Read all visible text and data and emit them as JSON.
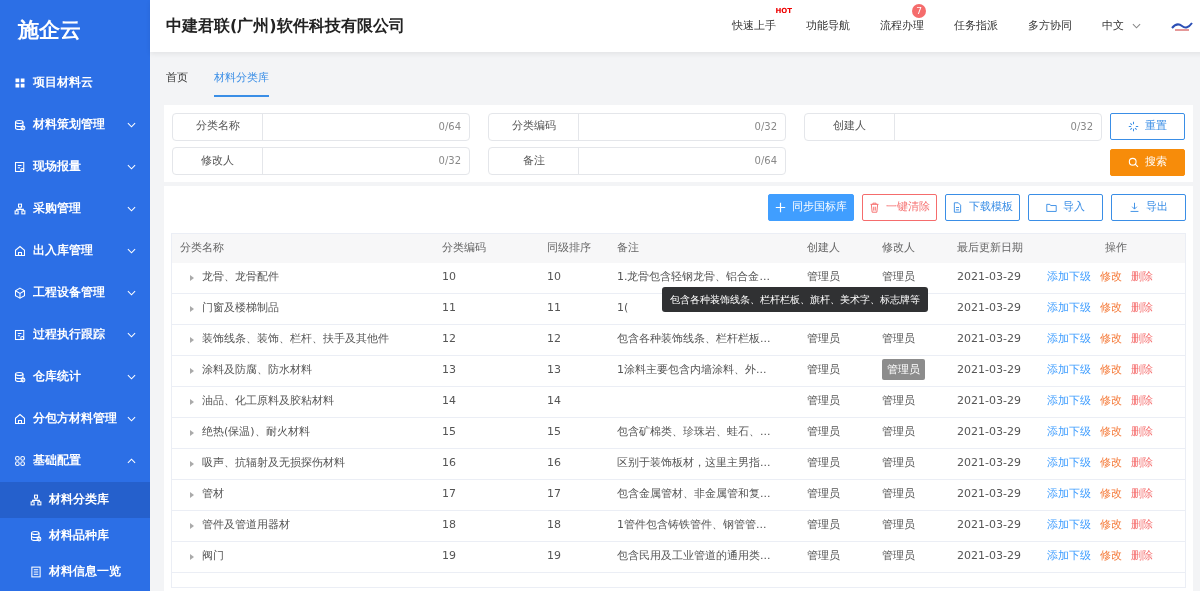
{
  "logo": {
    "text": "施企云"
  },
  "sidebar": {
    "items": [
      {
        "label": "项目材料云",
        "kind": "link"
      },
      {
        "label": "材料策划管理",
        "kind": "group",
        "expanded": false
      },
      {
        "label": "现场报量",
        "kind": "group",
        "expanded": false
      },
      {
        "label": "采购管理",
        "kind": "group",
        "expanded": false
      },
      {
        "label": "出入库管理",
        "kind": "group",
        "expanded": false
      },
      {
        "label": "工程设备管理",
        "kind": "group",
        "expanded": false
      },
      {
        "label": "过程执行跟踪",
        "kind": "group",
        "expanded": false
      },
      {
        "label": "仓库统计",
        "kind": "group",
        "expanded": false
      },
      {
        "label": "分包方材料管理",
        "kind": "group",
        "expanded": false
      },
      {
        "label": "基础配置",
        "kind": "group",
        "expanded": true,
        "children": [
          {
            "label": "材料分类库",
            "selected": true
          },
          {
            "label": "材料品种库",
            "selected": false
          },
          {
            "label": "材料信息一览",
            "selected": false
          }
        ]
      }
    ]
  },
  "header": {
    "company": "中建君联(广州)软件科技有限公司",
    "nav": [
      {
        "label": "快速上手",
        "hot": "HOT"
      },
      {
        "label": "功能导航"
      },
      {
        "label": "流程办理",
        "badge": "7"
      },
      {
        "label": "任务指派"
      },
      {
        "label": "多方协同"
      }
    ],
    "language": "中文"
  },
  "tabs": [
    {
      "label": "首页",
      "selected": false
    },
    {
      "label": "材料分类库",
      "selected": true
    }
  ],
  "filters": [
    {
      "label": "分类名称",
      "counter": "0/64"
    },
    {
      "label": "分类编码",
      "counter": "0/32"
    },
    {
      "label": "创建人",
      "counter": "0/32"
    },
    {
      "label": "修改人",
      "counter": "0/32"
    },
    {
      "label": "备注",
      "counter": "0/64"
    }
  ],
  "filter_buttons": [
    {
      "label": "重置",
      "kind": "reset"
    },
    {
      "label": "搜索",
      "kind": "search"
    }
  ],
  "toolbar": [
    {
      "label": "同步国标库",
      "kind": "primary"
    },
    {
      "label": "一键清除",
      "kind": "danger"
    },
    {
      "label": "下载模板",
      "kind": "file"
    },
    {
      "label": "导入",
      "kind": "folder"
    },
    {
      "label": "导出",
      "kind": "download"
    }
  ],
  "table": {
    "columns": [
      "分类名称",
      "分类编码",
      "同级排序",
      "备注",
      "创建人",
      "修改人",
      "最后更新日期",
      "操作"
    ],
    "rows": [
      {
        "name": "龙骨、龙骨配件",
        "code": "10",
        "sort": "10",
        "note": "1.龙骨包含轻钢龙骨、铝合金...",
        "creator": "管理员",
        "modifier": "管理员",
        "date": "2021-03-29",
        "actions": [
          "添加下级",
          "修改",
          "删除"
        ]
      },
      {
        "name": "门窗及楼梯制品",
        "code": "11",
        "sort": "11",
        "note": "1(",
        "note_tooltip": "包含各种装饰线条、栏杆栏板、旗杆、美术字、标志牌等",
        "date": "2021-03-29",
        "actions": [
          "添加下级",
          "修改",
          "删除"
        ]
      },
      {
        "name": "装饰线条、装饰、栏杆、扶手及其他件",
        "code": "12",
        "sort": "12",
        "note": "包含各种装饰线条、栏杆栏板...",
        "creator": "管理员",
        "modifier": "管理员",
        "date": "2021-03-29",
        "actions": [
          "添加下级",
          "修改",
          "删除"
        ]
      },
      {
        "name": "涂料及防腐、防水材料",
        "code": "13",
        "sort": "13",
        "note": "1涂料主要包含内墙涂料、外...",
        "creator": "管理员",
        "modifier": "管理员",
        "modifier_hovered": true,
        "date": "2021-03-29",
        "actions": [
          "添加下级",
          "修改",
          "删除"
        ]
      },
      {
        "name": "油品、化工原料及胶粘材料",
        "code": "14",
        "sort": "14",
        "creator": "管理员",
        "modifier": "管理员",
        "date": "2021-03-29",
        "actions": [
          "添加下级",
          "修改",
          "删除"
        ]
      },
      {
        "name": "绝热(保温)、耐火材料",
        "code": "15",
        "sort": "15",
        "note": "包含矿棉类、珍珠岩、蛙石、...",
        "creator": "管理员",
        "modifier": "管理员",
        "date": "2021-03-29",
        "actions": [
          "添加下级",
          "修改",
          "删除"
        ]
      },
      {
        "name": "吸声、抗辐射及无损探伤材料",
        "code": "16",
        "sort": "16",
        "note": "区别于装饰板材，这里主男指...",
        "creator": "管理员",
        "modifier": "管理员",
        "date": "2021-03-29",
        "actions": [
          "添加下级",
          "修改",
          "删除"
        ]
      },
      {
        "name": "管材",
        "code": "17",
        "sort": "17",
        "note": "包含金属管材、非金属管和复...",
        "creator": "管理员",
        "modifier": "管理员",
        "date": "2021-03-29",
        "actions": [
          "添加下级",
          "修改",
          "删除"
        ]
      },
      {
        "name": "管件及管道用器材",
        "code": "18",
        "sort": "18",
        "note": "1管件包含铸铁管件、钢管管...",
        "creator": "管理员",
        "modifier": "管理员",
        "date": "2021-03-29",
        "actions": [
          "添加下级",
          "修改",
          "删除"
        ]
      },
      {
        "name": "阀门",
        "code": "19",
        "sort": "19",
        "note": "包含民用及工业管道的通用类...",
        "creator": "管理员",
        "modifier": "管理员",
        "date": "2021-03-29",
        "actions": [
          "添加下级",
          "修改",
          "删除"
        ]
      }
    ]
  }
}
